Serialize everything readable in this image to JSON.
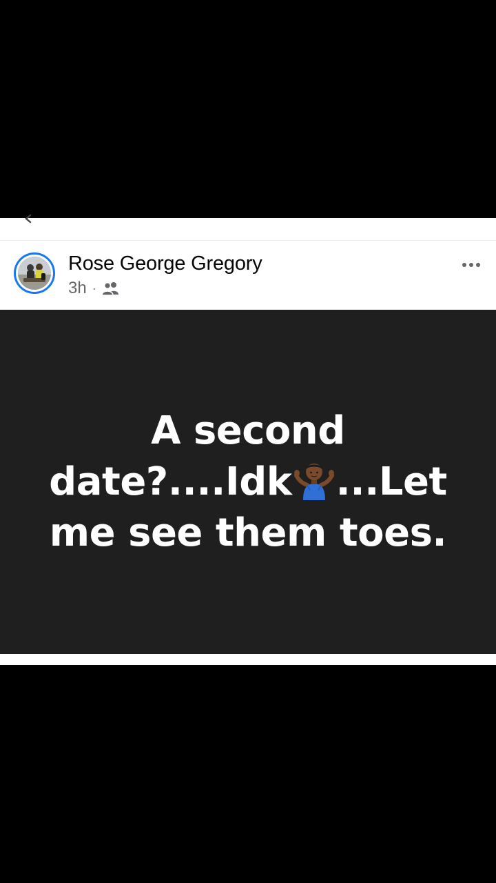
{
  "post": {
    "author": "Rose George Gregory",
    "time": "3h",
    "separator": "·",
    "audience_icon": "friends-icon",
    "more_icon": "more-options-icon",
    "text_before_emoji": "A second date?....Idk",
    "emoji": "person-shrugging-emoji",
    "text_after_emoji": "...Let me see them toes.",
    "image_background": "#1f1f1f"
  },
  "colors": {
    "accent": "#1877f2",
    "name": "#050505",
    "meta": "#65676b"
  }
}
